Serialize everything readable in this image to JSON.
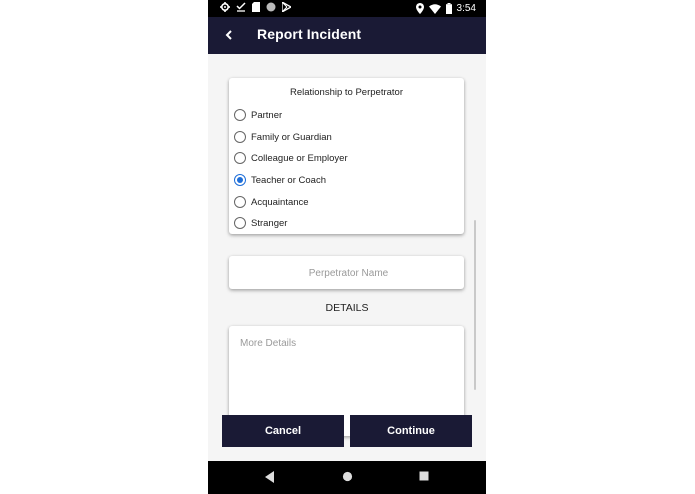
{
  "status_bar": {
    "time": "3:54",
    "icons_left": [
      "settings-icon",
      "check-icon",
      "sim-card-icon",
      "circle-icon",
      "play-store-icon"
    ],
    "icons_right": [
      "location-icon",
      "wifi-icon",
      "battery-icon"
    ]
  },
  "app_bar": {
    "title": "Report Incident",
    "back_icon": "chevron-left-icon"
  },
  "relationship": {
    "title": "Relationship to Perpetrator",
    "selected": "Teacher or Coach",
    "options": [
      {
        "label": "Partner",
        "checked": false
      },
      {
        "label": "Family or Guardian",
        "checked": false
      },
      {
        "label": "Colleague or Employer",
        "checked": false
      },
      {
        "label": "Teacher or Coach",
        "checked": true
      },
      {
        "label": "Acquaintance",
        "checked": false
      },
      {
        "label": "Stranger",
        "checked": false
      }
    ]
  },
  "perpetrator": {
    "placeholder": "Perpetrator Name",
    "value": ""
  },
  "details": {
    "heading": "DETAILS",
    "placeholder": "More Details",
    "value": ""
  },
  "actions": {
    "cancel_label": "Cancel",
    "continue_label": "Continue"
  },
  "nav_bar": {
    "icons": [
      "back-triangle-icon",
      "home-circle-icon",
      "recents-square-icon"
    ]
  },
  "colors": {
    "app_bar": "#1a1a35",
    "accent": "#1e6ed8",
    "background": "#f5f5f5"
  }
}
